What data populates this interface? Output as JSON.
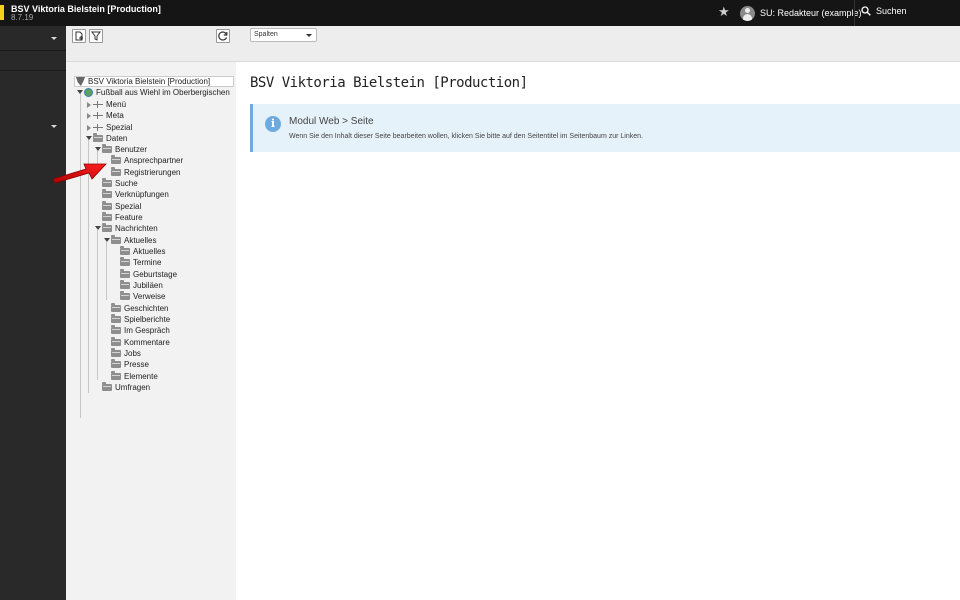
{
  "topbar": {
    "site_title": "BSV Viktoria Bielstein [Production]",
    "version": "8.7.19",
    "user_label": "SU: Redakteur (example)",
    "search_label": "Suchen"
  },
  "docheader": {
    "view_select": "Spalten"
  },
  "tree": {
    "root_label": "BSV Viktoria Bielstein [Production]",
    "nodes": [
      {
        "label": "Fußball aus Wiehl im Oberbergischen"
      },
      {
        "label": "Menü"
      },
      {
        "label": "Meta"
      },
      {
        "label": "Spezial"
      },
      {
        "label": "Daten"
      },
      {
        "label": "Benutzer"
      },
      {
        "label": "Ansprechpartner"
      },
      {
        "label": "Registrierungen"
      },
      {
        "label": "Suche"
      },
      {
        "label": "Verknüpfungen"
      },
      {
        "label": "Spezial"
      },
      {
        "label": "Feature"
      },
      {
        "label": "Nachrichten"
      },
      {
        "label": "Aktuelles"
      },
      {
        "label": "Aktuelles"
      },
      {
        "label": "Termine"
      },
      {
        "label": "Geburtstage"
      },
      {
        "label": "Jubiläen"
      },
      {
        "label": "Verweise"
      },
      {
        "label": "Geschichten"
      },
      {
        "label": "Spielberichte"
      },
      {
        "label": "Im Gespräch"
      },
      {
        "label": "Kommentare"
      },
      {
        "label": "Jobs"
      },
      {
        "label": "Presse"
      },
      {
        "label": "Elemente"
      },
      {
        "label": "Umfragen"
      }
    ]
  },
  "main": {
    "heading": "BSV Viktoria Bielstein [Production]",
    "callout_title": "Modul Web > Seite",
    "callout_text": "Wenn Sie den Inhalt dieser Seite bearbeiten wollen, klicken Sie bitte auf den Seitentitel im Seitenbaum zur Linken."
  },
  "colors": {
    "topbar_bg": "#151515",
    "logo_accent": "#f5d11a",
    "callout_bg": "#e5f2fa",
    "callout_accent": "#6daae0",
    "annotation_arrow": "#e01010"
  }
}
